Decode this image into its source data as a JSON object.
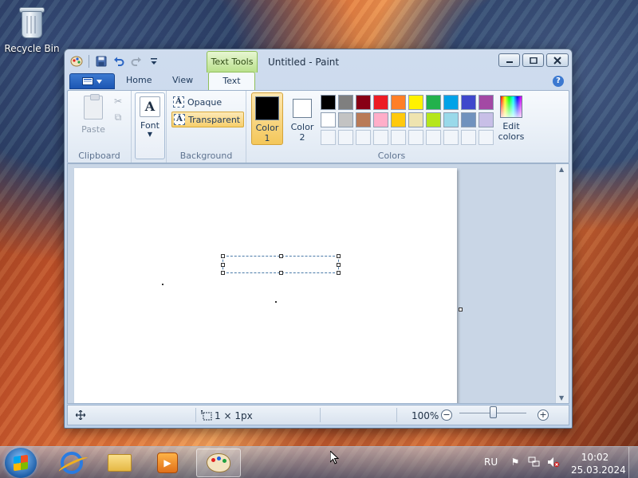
{
  "desktop": {
    "icons": [
      {
        "label": "Recycle Bin",
        "icon": "recycle-bin-icon"
      }
    ]
  },
  "window": {
    "title": "Untitled - Paint",
    "context_tab_group": "Text Tools",
    "quick_access": [
      "paint-app-icon",
      "save-icon",
      "undo-icon",
      "redo-icon",
      "customize-qat-icon"
    ],
    "tabs": {
      "home": "Home",
      "view": "View",
      "text": "Text",
      "active": "Text"
    },
    "ribbon": {
      "clipboard": {
        "group_label": "Clipboard",
        "paste_label": "Paste"
      },
      "font": {
        "label": "Font"
      },
      "background": {
        "group_label": "Background",
        "opaque_label": "Opaque",
        "transparent_label": "Transparent",
        "selected": "Transparent"
      },
      "colors": {
        "group_label": "Colors",
        "color1_label": "Color 1",
        "color1_value": "#000000",
        "color2_label": "Color 2",
        "color2_value": "#ffffff",
        "edit_colors_label": "Edit colors",
        "palette_row1": [
          "#000000",
          "#7f7f7f",
          "#880015",
          "#ed1c24",
          "#ff7f27",
          "#fff200",
          "#22b14c",
          "#00a2e8",
          "#3f48cc",
          "#a349a4"
        ],
        "palette_row2": [
          "#ffffff",
          "#c3c3c3",
          "#b97a57",
          "#ffaec9",
          "#ffc90e",
          "#efe4b0",
          "#b5e61d",
          "#99d9ea",
          "#7092be",
          "#c8bfe7"
        ],
        "palette_row3_empty_count": 10
      }
    },
    "statusbar": {
      "selection_size": "1 × 1px",
      "zoom": "100%"
    }
  },
  "taskbar": {
    "apps": [
      "internet-explorer-icon",
      "windows-explorer-icon",
      "media-player-icon",
      "paint-icon"
    ],
    "active_app": "paint-icon",
    "language": "RU",
    "time": "10:02",
    "date": "25.03.2024"
  }
}
